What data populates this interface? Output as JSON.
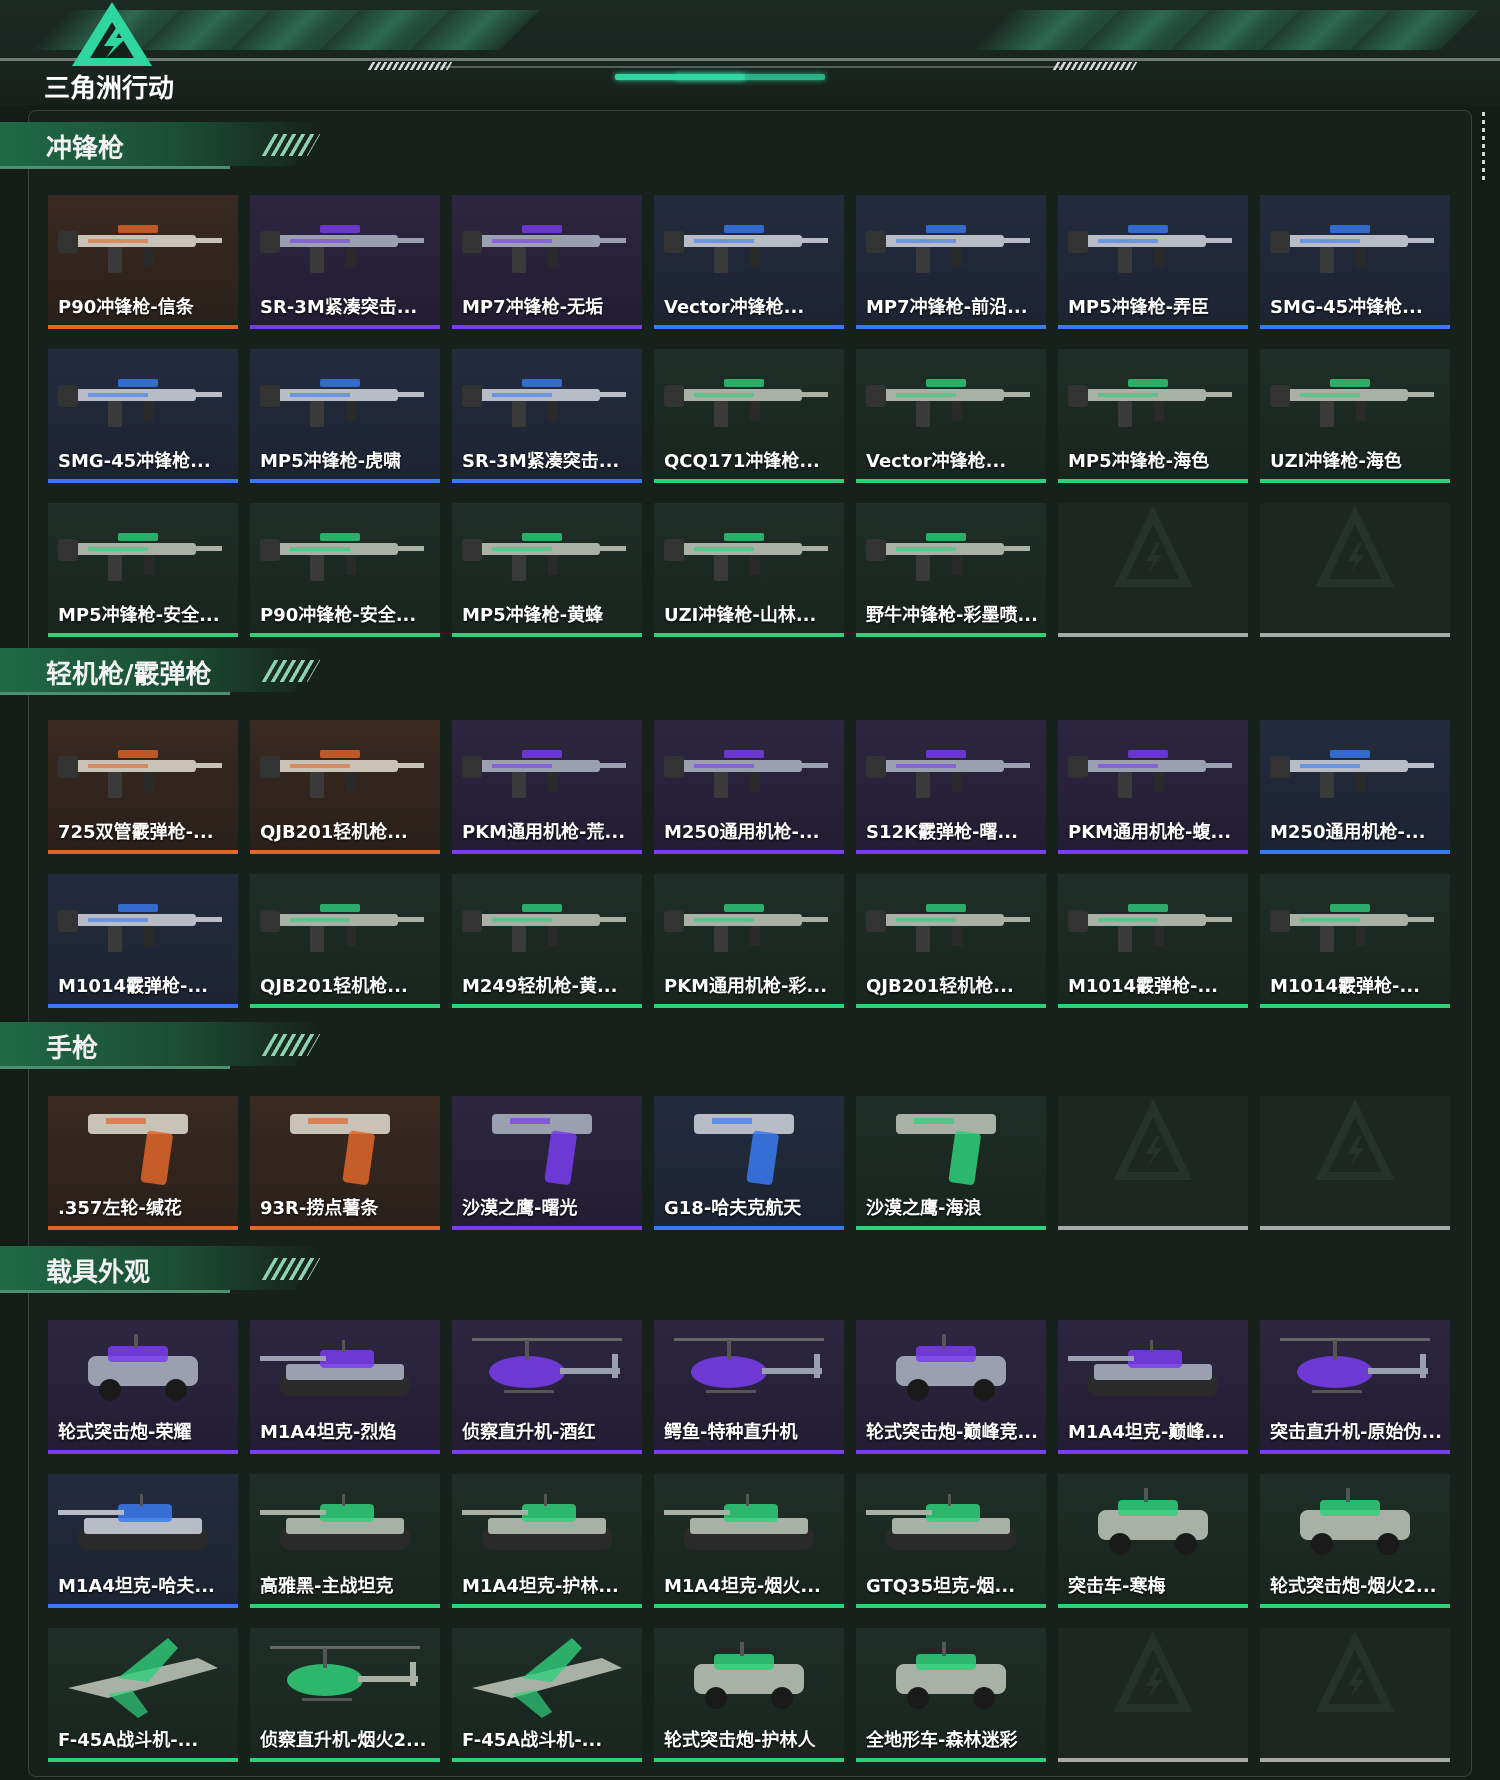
{
  "header": {
    "logo_text": "三角洲行动"
  },
  "sections": [
    {
      "title": "冲锋枪",
      "items": [
        {
          "name": "P90冲锋枪-信条",
          "rarity": "orange",
          "kind": "gun"
        },
        {
          "name": "SR-3M紧凑突击...",
          "rarity": "purple",
          "kind": "gun"
        },
        {
          "name": "MP7冲锋枪-无垢",
          "rarity": "purple",
          "kind": "gun"
        },
        {
          "name": "Vector冲锋枪...",
          "rarity": "blue",
          "kind": "gun"
        },
        {
          "name": "MP7冲锋枪-前沿...",
          "rarity": "blue",
          "kind": "gun"
        },
        {
          "name": "MP5冲锋枪-弄臣",
          "rarity": "blue",
          "kind": "gun"
        },
        {
          "name": "SMG-45冲锋枪...",
          "rarity": "blue",
          "kind": "gun"
        },
        {
          "name": "SMG-45冲锋枪...",
          "rarity": "blue",
          "kind": "gun"
        },
        {
          "name": "MP5冲锋枪-虎啸",
          "rarity": "blue",
          "kind": "gun"
        },
        {
          "name": "SR-3M紧凑突击...",
          "rarity": "blue",
          "kind": "gun"
        },
        {
          "name": "QCQ171冲锋枪...",
          "rarity": "green",
          "kind": "gun"
        },
        {
          "name": "Vector冲锋枪...",
          "rarity": "green",
          "kind": "gun"
        },
        {
          "name": "MP5冲锋枪-海色",
          "rarity": "green",
          "kind": "gun"
        },
        {
          "name": "UZI冲锋枪-海色",
          "rarity": "green",
          "kind": "gun"
        },
        {
          "name": "MP5冲锋枪-安全...",
          "rarity": "green",
          "kind": "gun"
        },
        {
          "name": "P90冲锋枪-安全...",
          "rarity": "green",
          "kind": "gun"
        },
        {
          "name": "MP5冲锋枪-黄蜂",
          "rarity": "green",
          "kind": "gun"
        },
        {
          "name": "UZI冲锋枪-山林...",
          "rarity": "green",
          "kind": "gun"
        },
        {
          "name": "野牛冲锋枪-彩墨喷...",
          "rarity": "green",
          "kind": "gun"
        },
        {
          "name": "",
          "rarity": "empty",
          "kind": "empty"
        },
        {
          "name": "",
          "rarity": "empty",
          "kind": "empty"
        }
      ]
    },
    {
      "title": "轻机枪/霰弹枪",
      "items": [
        {
          "name": "725双管霰弹枪-...",
          "rarity": "orange",
          "kind": "gun"
        },
        {
          "name": "QJB201轻机枪...",
          "rarity": "orange",
          "kind": "gun"
        },
        {
          "name": "PKM通用机枪-荒...",
          "rarity": "purple",
          "kind": "gun"
        },
        {
          "name": "M250通用机枪-...",
          "rarity": "purple",
          "kind": "gun"
        },
        {
          "name": "S12K霰弹枪-曙...",
          "rarity": "purple",
          "kind": "gun"
        },
        {
          "name": "PKM通用机枪-蝮...",
          "rarity": "purple",
          "kind": "gun"
        },
        {
          "name": "M250通用机枪-...",
          "rarity": "blue",
          "kind": "gun"
        },
        {
          "name": "M1014霰弹枪-...",
          "rarity": "blue",
          "kind": "gun"
        },
        {
          "name": "QJB201轻机枪...",
          "rarity": "green",
          "kind": "gun"
        },
        {
          "name": "M249轻机枪-黄...",
          "rarity": "green",
          "kind": "gun"
        },
        {
          "name": "PKM通用机枪-彩...",
          "rarity": "green",
          "kind": "gun"
        },
        {
          "name": "QJB201轻机枪...",
          "rarity": "green",
          "kind": "gun"
        },
        {
          "name": "M1014霰弹枪-...",
          "rarity": "green",
          "kind": "gun"
        },
        {
          "name": "M1014霰弹枪-...",
          "rarity": "green",
          "kind": "gun"
        }
      ]
    },
    {
      "title": "手枪",
      "items": [
        {
          "name": ".357左轮-缄花",
          "rarity": "orange",
          "kind": "pistol"
        },
        {
          "name": "93R-捞点薯条",
          "rarity": "orange",
          "kind": "pistol"
        },
        {
          "name": "沙漠之鹰-曙光",
          "rarity": "purple",
          "kind": "pistol"
        },
        {
          "name": "G18-哈夫克航天",
          "rarity": "blue",
          "kind": "pistol"
        },
        {
          "name": "沙漠之鹰-海浪",
          "rarity": "green",
          "kind": "pistol"
        },
        {
          "name": "",
          "rarity": "empty",
          "kind": "empty"
        },
        {
          "name": "",
          "rarity": "empty",
          "kind": "empty"
        }
      ]
    },
    {
      "title": "载具外观",
      "items": [
        {
          "name": "轮式突击炮-荣耀",
          "rarity": "purple",
          "kind": "vehicle"
        },
        {
          "name": "M1A4坦克-烈焰",
          "rarity": "purple",
          "kind": "tank"
        },
        {
          "name": "侦察直升机-酒红",
          "rarity": "purple",
          "kind": "heli"
        },
        {
          "name": "鳄鱼-特种直升机",
          "rarity": "purple",
          "kind": "heli"
        },
        {
          "name": "轮式突击炮-巅峰竞...",
          "rarity": "purple",
          "kind": "vehicle"
        },
        {
          "name": "M1A4坦克-巅峰...",
          "rarity": "purple",
          "kind": "tank"
        },
        {
          "name": "突击直升机-原始伪...",
          "rarity": "purple",
          "kind": "heli"
        },
        {
          "name": "M1A4坦克-哈夫...",
          "rarity": "blue",
          "kind": "tank"
        },
        {
          "name": "高雅黑-主战坦克",
          "rarity": "green",
          "kind": "tank"
        },
        {
          "name": "M1A4坦克-护林...",
          "rarity": "green",
          "kind": "tank"
        },
        {
          "name": "M1A4坦克-烟火...",
          "rarity": "green",
          "kind": "tank"
        },
        {
          "name": "GTQ35坦克-烟...",
          "rarity": "green",
          "kind": "tank"
        },
        {
          "name": "突击车-寒梅",
          "rarity": "green",
          "kind": "vehicle"
        },
        {
          "name": "轮式突击炮-烟火2...",
          "rarity": "green",
          "kind": "vehicle"
        },
        {
          "name": "F-45A战斗机-...",
          "rarity": "green",
          "kind": "jet"
        },
        {
          "name": "侦察直升机-烟火2...",
          "rarity": "green",
          "kind": "heli"
        },
        {
          "name": "F-45A战斗机-...",
          "rarity": "green",
          "kind": "jet"
        },
        {
          "name": "轮式突击炮-护林人",
          "rarity": "green",
          "kind": "vehicle"
        },
        {
          "name": "全地形车-森林迷彩",
          "rarity": "green",
          "kind": "vehicle"
        },
        {
          "name": "",
          "rarity": "empty",
          "kind": "empty"
        },
        {
          "name": "",
          "rarity": "empty",
          "kind": "empty"
        }
      ]
    }
  ],
  "colors": {
    "orange": "#e0662a",
    "purple": "#7a3cf0",
    "blue": "#3a7af0",
    "green": "#30d07a",
    "accent": "#2fd6a0"
  }
}
